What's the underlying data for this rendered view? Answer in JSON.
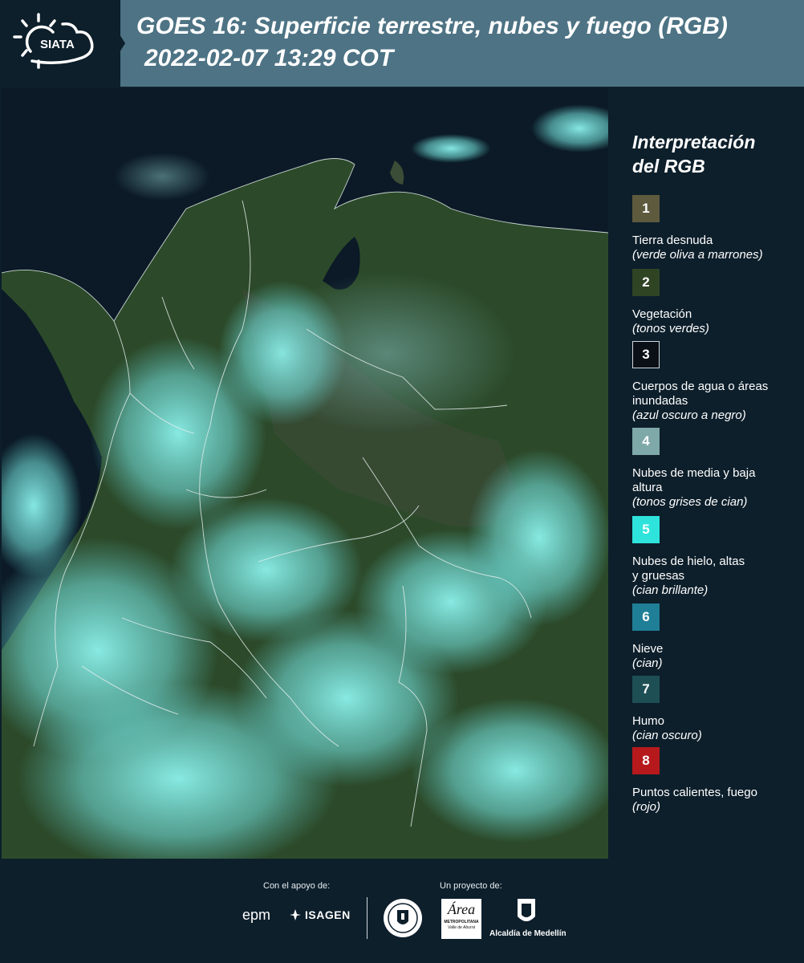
{
  "header": {
    "title": "GOES 16: Superficie terrestre, nubes y fuego (RGB)",
    "subtitle": "2022-02-07 13:29 COT",
    "logo_text": "SIATA"
  },
  "legend": {
    "title_line1": "Interpretación",
    "title_line2": "del RGB",
    "items": [
      {
        "number": "1",
        "name": "Tierra desnuda",
        "desc": "(verde oliva a marrones)",
        "color": "#5e5a3d"
      },
      {
        "number": "2",
        "name": "Vegetación",
        "desc": "(tonos verdes)",
        "color": "#2f4423"
      },
      {
        "number": "3",
        "name": "Cuerpos de agua o áreas inundadas",
        "desc": "(azul oscuro a negro)",
        "color": "#0a1016"
      },
      {
        "number": "4",
        "name": "Nubes de media y baja altura",
        "desc": "(tonos grises de cian)",
        "color": "#7fa8a8"
      },
      {
        "number": "5",
        "name": "Nubes de hielo, altas y gruesas",
        "desc": "(cian brillante)",
        "color": "#2ee3dc"
      },
      {
        "number": "6",
        "name": "Nieve",
        "desc": "(cian)",
        "color": "#1f7f96"
      },
      {
        "number": "7",
        "name": "Humo",
        "desc": "(cian oscuro)",
        "color": "#1d4f55"
      },
      {
        "number": "8",
        "name": "Puntos calientes, fuego",
        "desc": "(rojo)",
        "color": "#b5191c"
      }
    ]
  },
  "footer": {
    "support_label": "Con el apoyo de:",
    "project_label": "Un proyecto de:",
    "epm_text": "epm",
    "isagen_text": "ISAGEN",
    "metro_text_1": "Área",
    "metro_text_2": "METROPOLITANA",
    "metro_text_3": "Valle de Aburrá",
    "alcaldia_text": "Alcaldía de Medellín"
  },
  "colors": {
    "background": "#0d1f2b",
    "header_band": "#4d7384",
    "ocean": "#0b1a26",
    "land": "#2e4a2c",
    "cloud": "#7fe9e4"
  }
}
